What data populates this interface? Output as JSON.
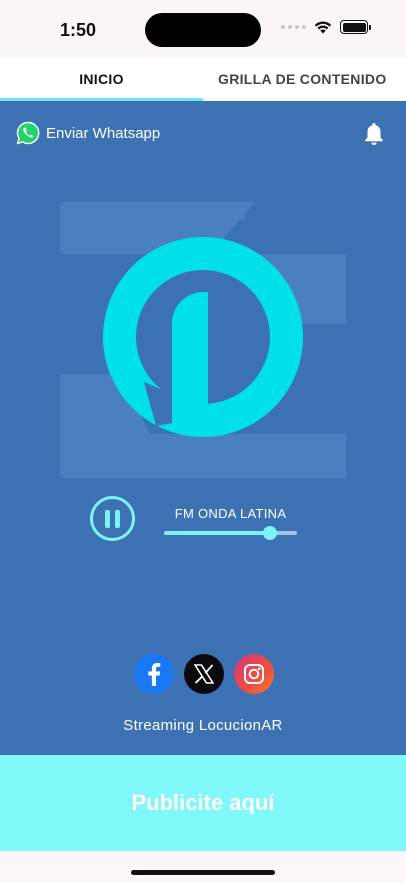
{
  "status_bar": {
    "time": "1:50"
  },
  "tabs": [
    {
      "label": "INICIO",
      "active": true
    },
    {
      "label": "GRILLA DE CONTENIDO",
      "active": false
    }
  ],
  "header": {
    "whatsapp_label": "Enviar Whatsapp",
    "whatsapp_icon": "whatsapp-icon",
    "bell_icon": "bell-icon"
  },
  "player": {
    "station_name": "FM ONDA LATINA",
    "state": "playing",
    "pause_icon": "pause-icon",
    "volume_level": 0.8
  },
  "socials": [
    {
      "name": "facebook",
      "icon": "facebook-icon"
    },
    {
      "name": "x",
      "icon": "x-icon"
    },
    {
      "name": "instagram",
      "icon": "instagram-icon"
    }
  ],
  "footer_label": "Streaming LocucionAR",
  "ad_banner": {
    "label": "Publicite aquí"
  },
  "colors": {
    "background": "#3c72b3",
    "accent": "#7ef3f7",
    "logo": "#00e0e8",
    "banner": "#80f8fa"
  }
}
